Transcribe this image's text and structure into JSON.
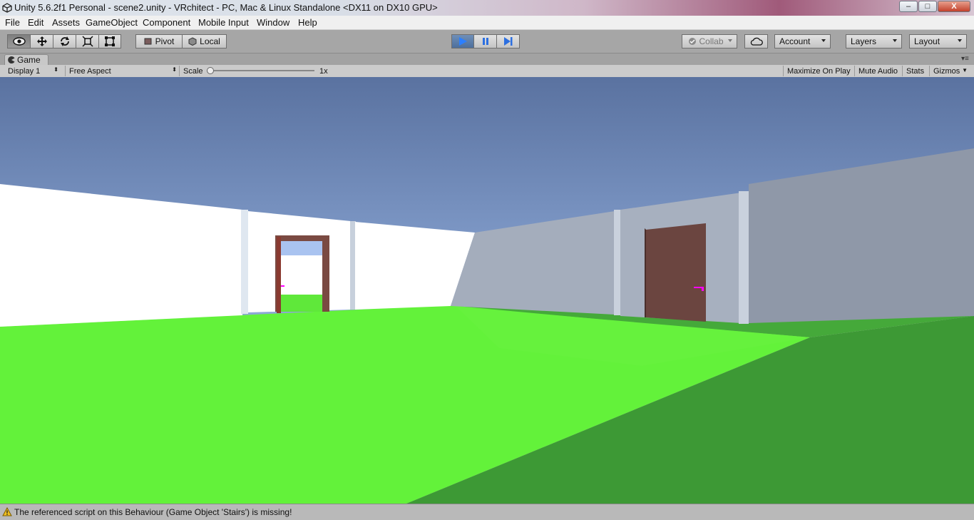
{
  "window": {
    "title": "Unity 5.6.2f1 Personal - scene2.unity - VRchitect - PC, Mac & Linux Standalone <DX11 on DX10 GPU>",
    "controls": {
      "minimize": "–",
      "maximize": "□",
      "close": "X"
    }
  },
  "menu": [
    "File",
    "Edit",
    "Assets",
    "GameObject",
    "Component",
    "Mobile Input",
    "Window",
    "Help"
  ],
  "toolbar": {
    "pivot_label": "Pivot",
    "local_label": "Local",
    "collab_label": "Collab",
    "account_label": "Account",
    "layers_label": "Layers",
    "layout_label": "Layout"
  },
  "game_view": {
    "tab_label": "Game",
    "display": "Display 1",
    "aspect": "Free Aspect",
    "scale_label": "Scale",
    "scale_value": "1x",
    "maximize_on_play": "Maximize On Play",
    "mute_audio": "Mute Audio",
    "stats": "Stats",
    "gizmos": "Gizmos"
  },
  "status": {
    "message": "The referenced script on this Behaviour (Game Object 'Stairs') is missing!"
  },
  "colors": {
    "sky_top": "#5b74a0",
    "sky_bottom": "#8aa4d2",
    "floor_light": "#63f23a",
    "floor_shadow": "#3a9a32",
    "door": "#6b4540",
    "accent_play": "#3b74d8"
  }
}
